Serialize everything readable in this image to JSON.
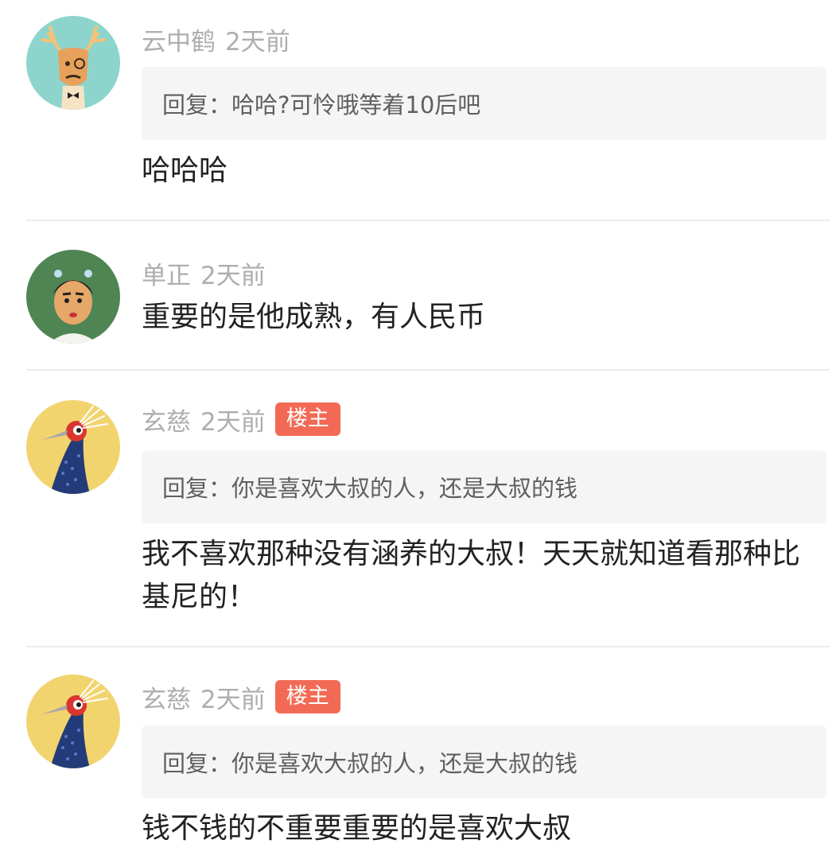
{
  "comments": [
    {
      "user": "云中鹤",
      "time": "2天前",
      "quote_label": "回复：",
      "quote_text": "哈哈?可怜哦等着10后吧",
      "content": "哈哈哈",
      "avatar": "deer-avatar-icon"
    },
    {
      "user": "单正",
      "time": "2天前",
      "content": "重要的是他成熟，有人民币",
      "avatar": "girl-avatar-icon"
    },
    {
      "user": "玄慈",
      "time": "2天前",
      "badge": "楼主",
      "quote_label": "回复：",
      "quote_text": "你是喜欢大叔的人，还是大叔的钱",
      "content": "我不喜欢那种没有涵养的大叔！天天就知道看那种比基尼的！",
      "avatar": "bird-avatar-icon"
    },
    {
      "user": "玄慈",
      "time": "2天前",
      "badge": "楼主",
      "quote_label": "回复：",
      "quote_text": "你是喜欢大叔的人，还是大叔的钱",
      "content": "钱不钱的不重要重要的是喜欢大叔",
      "avatar": "bird-avatar-icon"
    }
  ],
  "colors": {
    "badge_bg": "#f26a55",
    "meta_text": "#aeaeae",
    "quote_bg": "#f5f5f5"
  }
}
